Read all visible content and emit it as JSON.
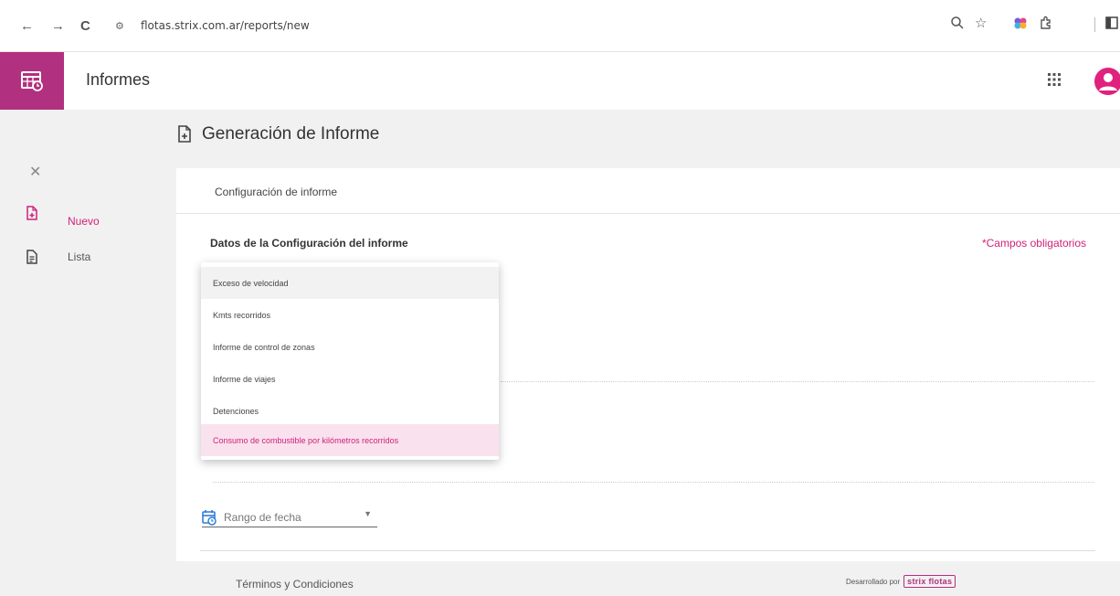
{
  "browser": {
    "url": "flotas.strix.com.ar/reports/new",
    "back": "←",
    "forward": "→",
    "reload": "C"
  },
  "app": {
    "title": "Informes",
    "accent_color": "#b1307f",
    "highlight_color": "#d0217a"
  },
  "sidebar": {
    "items": [
      {
        "label": "Nuevo",
        "icon": "file-add-icon",
        "active": true
      },
      {
        "label": "Lista",
        "icon": "file-list-icon",
        "active": false
      }
    ]
  },
  "page": {
    "title": "Generación de Informe",
    "card_header": "Configuración de informe",
    "section_title": "Datos de la Configuración del informe",
    "required_note": "*Campos obligatorios"
  },
  "dropdown": {
    "options": [
      {
        "label": "Exceso de velocidad",
        "state": "hover"
      },
      {
        "label": "Kmts recorridos",
        "state": ""
      },
      {
        "label": "Informe de control de zonas",
        "state": ""
      },
      {
        "label": "Informe de viajes",
        "state": ""
      },
      {
        "label": "Detenciones",
        "state": ""
      },
      {
        "label": "Consumo de combustible por kilómetros recorridos",
        "state": "selected"
      }
    ]
  },
  "date_range": {
    "label": "Rango de fecha"
  },
  "footer": {
    "terms": "Términos y Condiciones",
    "developed_by": "Desarrollado por",
    "brand": "strix flotas"
  }
}
